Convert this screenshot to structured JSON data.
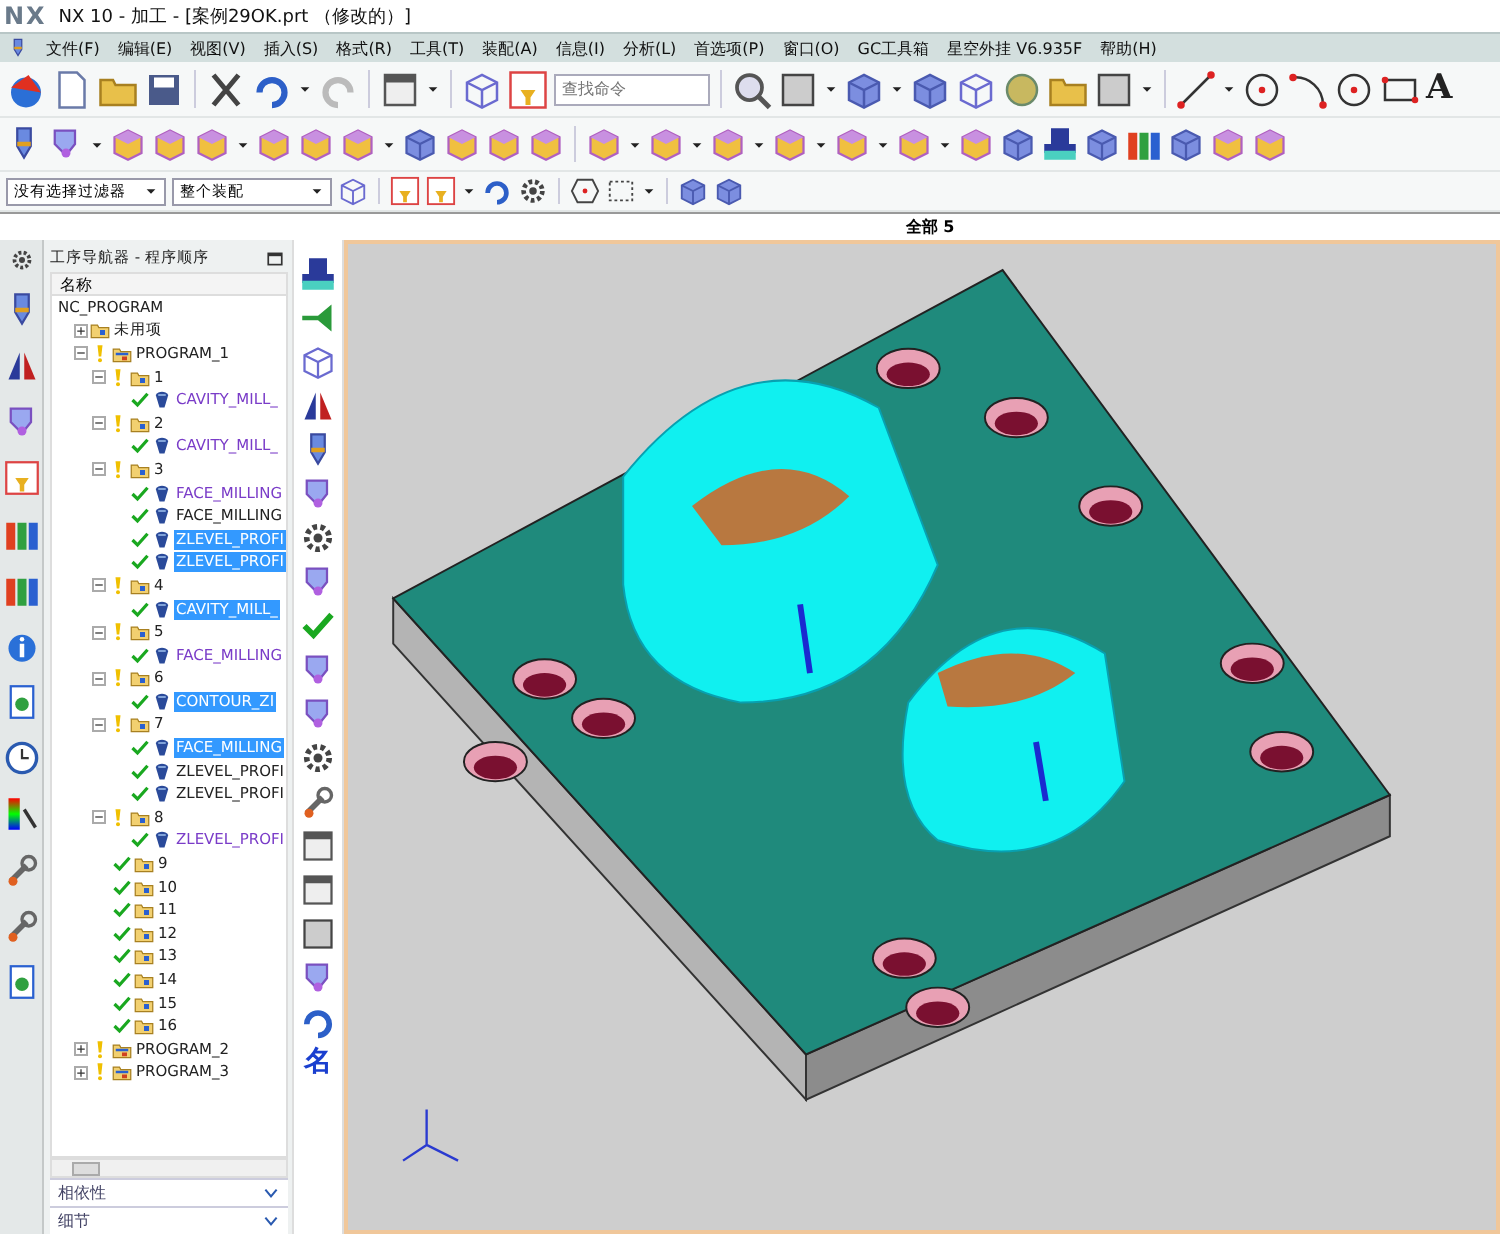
{
  "window": {
    "logo": "NX",
    "title": "NX 10 - 加工 - [案例29OK.prt （修改的）]"
  },
  "menu": [
    "文件(F)",
    "编辑(E)",
    "视图(V)",
    "插入(S)",
    "格式(R)",
    "工具(T)",
    "装配(A)",
    "信息(I)",
    "分析(L)",
    "首选项(P)",
    "窗口(O)",
    "GC工具箱",
    "星空外挂 V6.935F",
    "帮助(H)"
  ],
  "toolbar": {
    "search": {
      "placeholder": "查找命令"
    },
    "text_tool": "A"
  },
  "filters": [
    {
      "value": "没有选择过滤器"
    },
    {
      "value": "整个装配"
    }
  ],
  "view_header": "全部 5",
  "navigator": {
    "title": "工序导航器 - 程序顺序",
    "column": "名称",
    "tree": [
      {
        "label": "NC_PROGRAM",
        "kind": "root",
        "selected": false,
        "children": [
          {
            "label": "未用项",
            "kind": "group",
            "selected": false,
            "expanded": false
          },
          {
            "label": "PROGRAM_1",
            "kind": "program",
            "complete": false,
            "selected": false,
            "expanded": true,
            "children": [
              {
                "label": "1",
                "kind": "group",
                "complete": false,
                "selected": false,
                "expanded": true,
                "children": [
                  {
                    "label": "CAVITY_MILL_",
                    "kind": "operation",
                    "complete": true,
                    "selected": false,
                    "color": "#7a3cc8"
                  }
                ]
              },
              {
                "label": "2",
                "kind": "group",
                "complete": false,
                "selected": false,
                "expanded": true,
                "children": [
                  {
                    "label": "CAVITY_MILL_",
                    "kind": "operation",
                    "complete": true,
                    "selected": false,
                    "color": "#7a3cc8"
                  }
                ]
              },
              {
                "label": "3",
                "kind": "group",
                "complete": false,
                "selected": false,
                "expanded": true,
                "children": [
                  {
                    "label": "FACE_MILLING",
                    "kind": "operation",
                    "complete": true,
                    "selected": false,
                    "color": "#7a3cc8"
                  },
                  {
                    "label": "FACE_MILLING",
                    "kind": "operation",
                    "complete": true,
                    "selected": false,
                    "color": "#222222"
                  },
                  {
                    "label": "ZLEVEL_PROFI",
                    "kind": "operation",
                    "complete": true,
                    "selected": true
                  },
                  {
                    "label": "ZLEVEL_PROFI",
                    "kind": "operation",
                    "complete": true,
                    "selected": true
                  }
                ]
              },
              {
                "label": "4",
                "kind": "group",
                "complete": false,
                "selected": false,
                "expanded": true,
                "children": [
                  {
                    "label": "CAVITY_MILL_",
                    "kind": "operation",
                    "complete": true,
                    "selected": true
                  }
                ]
              },
              {
                "label": "5",
                "kind": "group",
                "complete": false,
                "selected": false,
                "expanded": true,
                "children": [
                  {
                    "label": "FACE_MILLING",
                    "kind": "operation",
                    "complete": true,
                    "selected": false,
                    "color": "#7a3cc8"
                  }
                ]
              },
              {
                "label": "6",
                "kind": "group",
                "complete": false,
                "selected": false,
                "expanded": true,
                "children": [
                  {
                    "label": "CONTOUR_ZI",
                    "kind": "operation",
                    "complete": true,
                    "selected": true
                  }
                ]
              },
              {
                "label": "7",
                "kind": "group",
                "complete": false,
                "selected": false,
                "expanded": true,
                "children": [
                  {
                    "label": "FACE_MILLING",
                    "kind": "operation",
                    "complete": true,
                    "selected": true
                  },
                  {
                    "label": "ZLEVEL_PROFI",
                    "kind": "operation",
                    "complete": true,
                    "selected": false,
                    "color": "#222222"
                  },
                  {
                    "label": "ZLEVEL_PROFI",
                    "kind": "operation",
                    "complete": true,
                    "selected": false,
                    "color": "#222222"
                  }
                ]
              },
              {
                "label": "8",
                "kind": "group",
                "complete": false,
                "selected": false,
                "expanded": true,
                "children": [
                  {
                    "label": "ZLEVEL_PROFI",
                    "kind": "operation",
                    "complete": true,
                    "selected": false,
                    "color": "#7a3cc8"
                  }
                ]
              },
              {
                "label": "9",
                "kind": "group",
                "complete": true,
                "selected": false
              },
              {
                "label": "10",
                "kind": "group",
                "complete": true,
                "selected": false
              },
              {
                "label": "11",
                "kind": "group",
                "complete": true,
                "selected": false
              },
              {
                "label": "12",
                "kind": "group",
                "complete": true,
                "selected": false
              },
              {
                "label": "13",
                "kind": "group",
                "complete": true,
                "selected": false
              },
              {
                "label": "14",
                "kind": "group",
                "complete": true,
                "selected": false
              },
              {
                "label": "15",
                "kind": "group",
                "complete": true,
                "selected": false
              },
              {
                "label": "16",
                "kind": "group",
                "complete": true,
                "selected": false
              }
            ]
          },
          {
            "label": "PROGRAM_2",
            "kind": "program",
            "complete": false,
            "selected": false,
            "expanded": false
          },
          {
            "label": "PROGRAM_3",
            "kind": "program",
            "complete": false,
            "selected": false,
            "expanded": false
          }
        ]
      }
    ],
    "panels": [
      {
        "label": "相依性",
        "expanded": false
      },
      {
        "label": "细节",
        "expanded": false
      }
    ]
  },
  "side_toolbar": {
    "name_tool": "名"
  }
}
